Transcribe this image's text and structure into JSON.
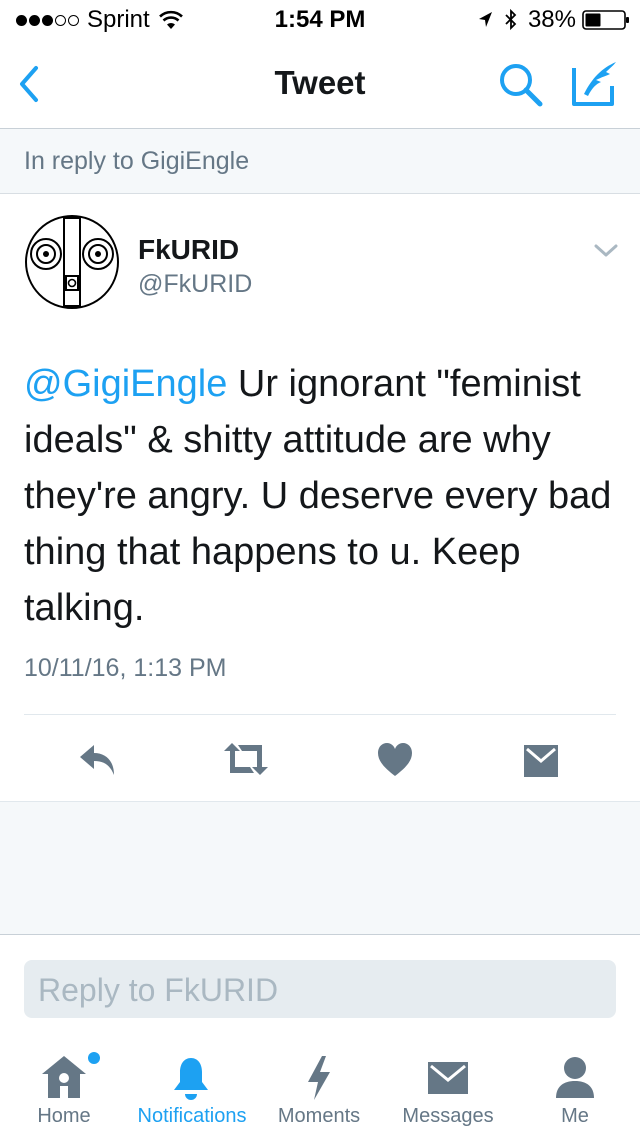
{
  "status_bar": {
    "carrier": "Sprint",
    "time": "1:54 PM",
    "battery": "38%"
  },
  "nav": {
    "title": "Tweet"
  },
  "reply_context": "In reply to GigiEngle",
  "tweet": {
    "display_name": "FkURID",
    "username": "@FkURID",
    "mention": "@GigiEngle",
    "text": " Ur ignorant \"feminist ideals\" & shitty attitude are why they're angry. U deserve every bad thing that happens to u. Keep talking.",
    "timestamp": "10/11/16, 1:13 PM"
  },
  "reply_field": {
    "placeholder": "Reply to FkURID"
  },
  "tabs": [
    {
      "label": "Home",
      "icon": "home-icon"
    },
    {
      "label": "Notifications",
      "icon": "bell-icon"
    },
    {
      "label": "Moments",
      "icon": "lightning-icon"
    },
    {
      "label": "Messages",
      "icon": "envelope-icon"
    },
    {
      "label": "Me",
      "icon": "person-icon"
    }
  ],
  "colors": {
    "accent": "#1da1f2",
    "muted": "#657786",
    "icon_gray": "#657786",
    "background_gray": "#f5f8fa"
  }
}
